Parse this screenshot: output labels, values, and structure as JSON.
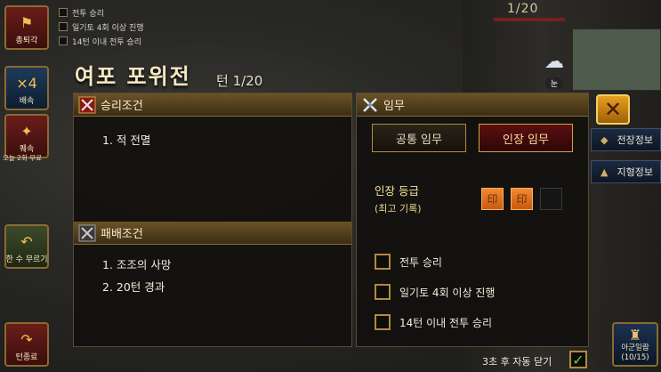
{
  "top_checklist": [
    {
      "label": "전투 승리"
    },
    {
      "label": "일기토 4회 이상 진행"
    },
    {
      "label": "14턴 이내 전투 승리"
    }
  ],
  "turn_counter": "1/20",
  "left_buttons": {
    "retreat": "총퇴각",
    "speed": "배속",
    "speed_value": "×4",
    "regroup": "퀘속",
    "regroup_note": "오늘 2회 무료",
    "undo": "한 수 무르기",
    "end_turn": "턴종료"
  },
  "battle": {
    "title": "여포 포위전",
    "turn": "턴 1/20"
  },
  "victory": {
    "heading": "승리조건",
    "conditions": [
      "1. 적 전멸"
    ]
  },
  "defeat": {
    "heading": "패배조건",
    "conditions": [
      "1. 조조의 사망",
      "2. 20턴 경과"
    ]
  },
  "mission": {
    "heading": "임무",
    "tabs": [
      "공통 임무",
      "인장 임무"
    ],
    "active_tab": 1,
    "grade_label": "인장 등급",
    "grade_sub": "(최고 기록)",
    "seals_earned": 2,
    "seals_total": 3,
    "tasks": [
      "전투 승리",
      "일기토 4회 이상 진행",
      "14턴 이내 전투 승리"
    ]
  },
  "right_side": {
    "weather": "눈",
    "battle_info": "전장정보",
    "terrain_info": "지형정보",
    "army_list": "아군일람",
    "army_count": "(10/15)"
  },
  "footer": {
    "auto_close": "3초 후 자동 닫기",
    "auto_close_checked": true
  },
  "colors": {
    "panel_header": "#6a5326",
    "active_tab": "#5a1010",
    "seal_earned": "#f08a30",
    "accent_gold": "#b08a40"
  }
}
